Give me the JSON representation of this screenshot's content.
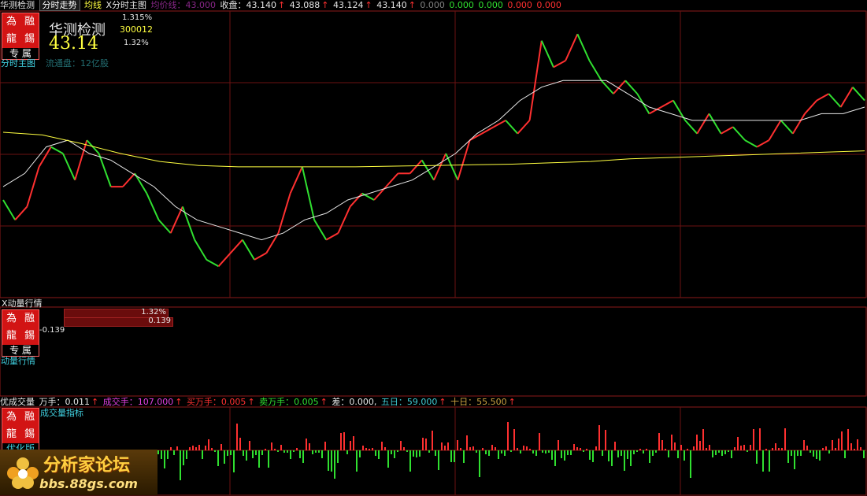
{
  "colors": {
    "up": "#ff3030",
    "down": "#30e030",
    "avg": "#ffff40",
    "grid": "#8b1a1a"
  },
  "main_header": {
    "title": "华测检测",
    "tab_active": "分时走势",
    "tab_avg": "均线",
    "tab_formula": "X分时主图",
    "faded": "均价线：43.000",
    "close_label": "收盘：43.140",
    "vals": [
      "43.088",
      "43.124",
      "43.140"
    ],
    "zeros": [
      "0.000",
      "0.000",
      "0.000",
      "0.000",
      "0.000"
    ]
  },
  "stock": {
    "name": "华测检测",
    "price": "43.14",
    "pct_top": "1.315%",
    "code": "300012",
    "pct2": "1.32%",
    "note": "流通盘：12亿股",
    "formula": "分时主图"
  },
  "badge": {
    "r1a": "為",
    "r1b": "融",
    "r2a": "龍",
    "r2b": "錫",
    "foot": "专 属"
  },
  "momentum": {
    "title": "X动量行情",
    "bar1": "1.32%",
    "bar2": "0.139",
    "neg": "-0.139",
    "label": "动量行情"
  },
  "volume": {
    "title": "优成交量",
    "wan": "万手：0.011",
    "chengjiao": "成交手：107.000",
    "buy": "买万手：0.005",
    "sell": "卖万手：0.005",
    "diff": "差：0.000,",
    "d5": "五日：59.000",
    "d10": "十日：55.500",
    "indicator": "成交量指标",
    "tag": "优化版"
  },
  "watermark": {
    "title": "分析家论坛",
    "url": "bbs.88gs.com"
  },
  "chart_data": {
    "type": "line",
    "series": [
      {
        "values": [
          42.4,
          42.1,
          42.3,
          42.9,
          43.2,
          43.1,
          42.7,
          43.3,
          43.1,
          42.6,
          42.6,
          42.8,
          42.5,
          42.1,
          41.9,
          42.3,
          41.8,
          41.5,
          41.4,
          41.6,
          41.8,
          41.5,
          41.6,
          41.9,
          42.5,
          42.9,
          42.1,
          41.8,
          41.9,
          42.3,
          42.5,
          42.4,
          42.6,
          42.8,
          42.8,
          43.0,
          42.7,
          43.1,
          42.7,
          43.3,
          43.4,
          43.5,
          43.6,
          43.4,
          43.6,
          44.8,
          44.4,
          44.5,
          44.9,
          44.5,
          44.2,
          44.0,
          44.2,
          44.0,
          43.7,
          43.8,
          43.9,
          43.6,
          43.4,
          43.7,
          43.4,
          43.5,
          43.3,
          43.2,
          43.3,
          43.6,
          43.4,
          43.7,
          43.9,
          44.0,
          43.8,
          44.1,
          43.9
        ]
      },
      {
        "values": [
          42.6,
          42.8,
          43.2,
          43.3,
          43.1,
          43.0,
          42.8,
          42.6,
          42.3,
          42.1,
          42.0,
          41.9,
          41.8,
          41.9,
          42.1,
          42.2,
          42.4,
          42.5,
          42.6,
          42.7,
          42.9,
          43.1,
          43.4,
          43.6,
          43.9,
          44.1,
          44.2,
          44.2,
          44.2,
          44.0,
          43.8,
          43.7,
          43.6,
          43.6,
          43.6,
          43.6,
          43.6,
          43.6,
          43.7,
          43.7,
          43.8
        ]
      },
      {
        "values": [
          43.42,
          43.38,
          43.25,
          43.1,
          42.98,
          42.92,
          42.9,
          42.9,
          42.9,
          42.9,
          42.91,
          42.92,
          42.93,
          42.94,
          42.96,
          42.98,
          43.02,
          43.04,
          43.06,
          43.08,
          43.1,
          43.12,
          43.14
        ]
      }
    ]
  }
}
